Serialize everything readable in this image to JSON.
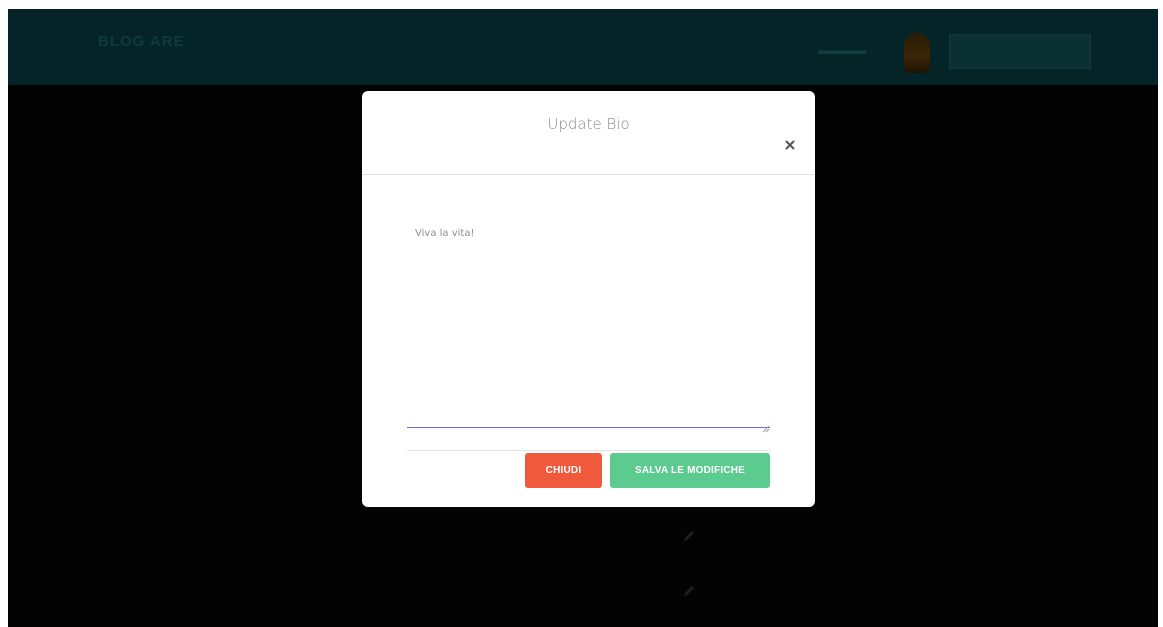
{
  "navbar": {
    "brand": "BLOG ARE"
  },
  "modal": {
    "title": "Update Bio",
    "close_icon": "close-icon",
    "bio_value": "Viva la vita!",
    "close_button_label": "CHIUDI",
    "save_button_label": "SALVA LE MODIFICHE"
  },
  "colors": {
    "backdrop": "#030303",
    "navbar": "#052427",
    "close_button": "#f05a3c",
    "save_button": "#5bcb8f",
    "textarea_focus_underline": "#6f6ce8",
    "title_text": "#8a8a8a"
  }
}
